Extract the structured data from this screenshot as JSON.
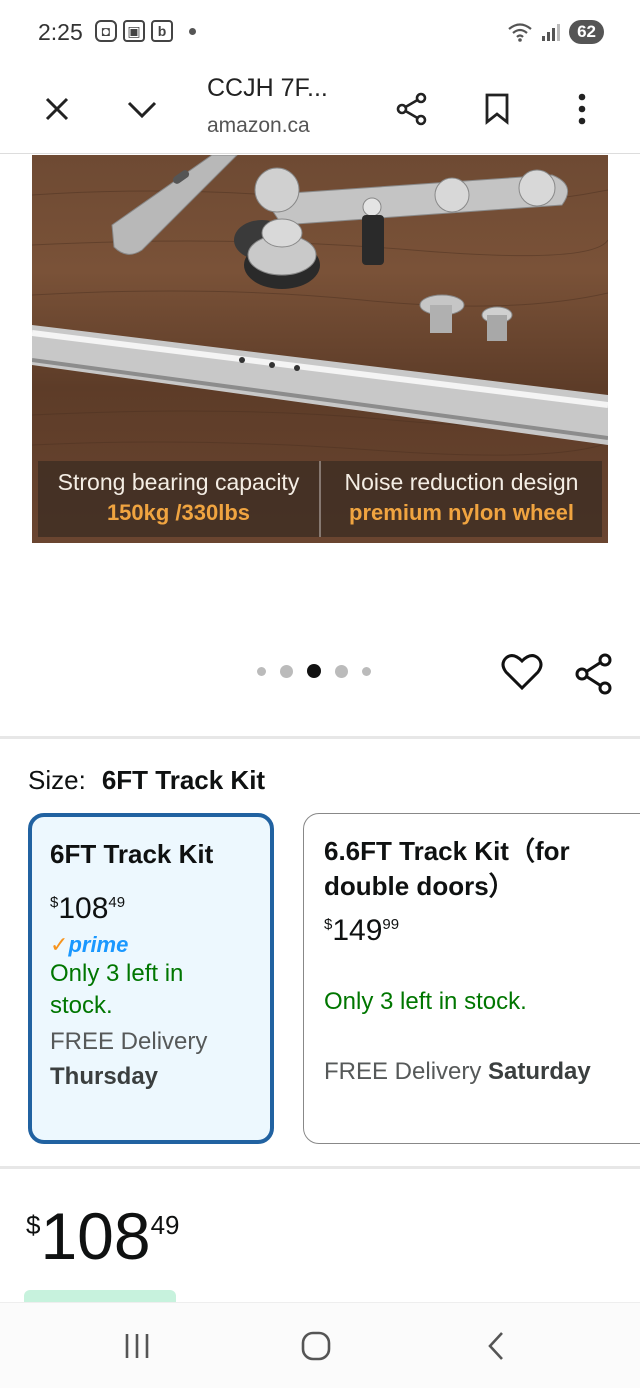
{
  "status_bar": {
    "time": "2:25",
    "notif_icons": [
      "screenshot-icon",
      "cast-icon",
      "b"
    ],
    "battery": "62"
  },
  "browser": {
    "title": "CCJH 7F...",
    "url": "amazon.ca"
  },
  "product_image": {
    "captions": [
      {
        "line1": "Strong bearing capacity",
        "line2": "150kg /330lbs"
      },
      {
        "line1": "Noise reduction design",
        "line2": "premium nylon wheel"
      }
    ],
    "carousel": {
      "count": 5,
      "active_index": 2
    }
  },
  "size": {
    "label": "Size:",
    "value": "6FT Track Kit"
  },
  "options": [
    {
      "name": "6FT Track Kit",
      "currency": "$",
      "price_whole": "108",
      "price_frac": "49",
      "prime": "prime",
      "stock_line1": "Only 3 left in",
      "stock_line2": "stock.",
      "delivery_prefix": "FREE Delivery",
      "delivery_day": "Thursday"
    },
    {
      "name_line1": "6.6FT Track Kit（for",
      "name_line2": "double doors）",
      "currency": "$",
      "price_whole": "149",
      "price_frac": "99",
      "stock": "Only 3 left in stock.",
      "delivery_prefix": "FREE Delivery",
      "delivery_day": "Saturday"
    }
  ],
  "main_price": {
    "currency": "$",
    "whole": "108",
    "frac": "49"
  },
  "colors": {
    "selected_border": "#2162a1",
    "selected_bg": "#edf8fe",
    "stock_green": "#007600",
    "prime_blue": "#1a98ff",
    "caption_orange": "#f0a440"
  }
}
